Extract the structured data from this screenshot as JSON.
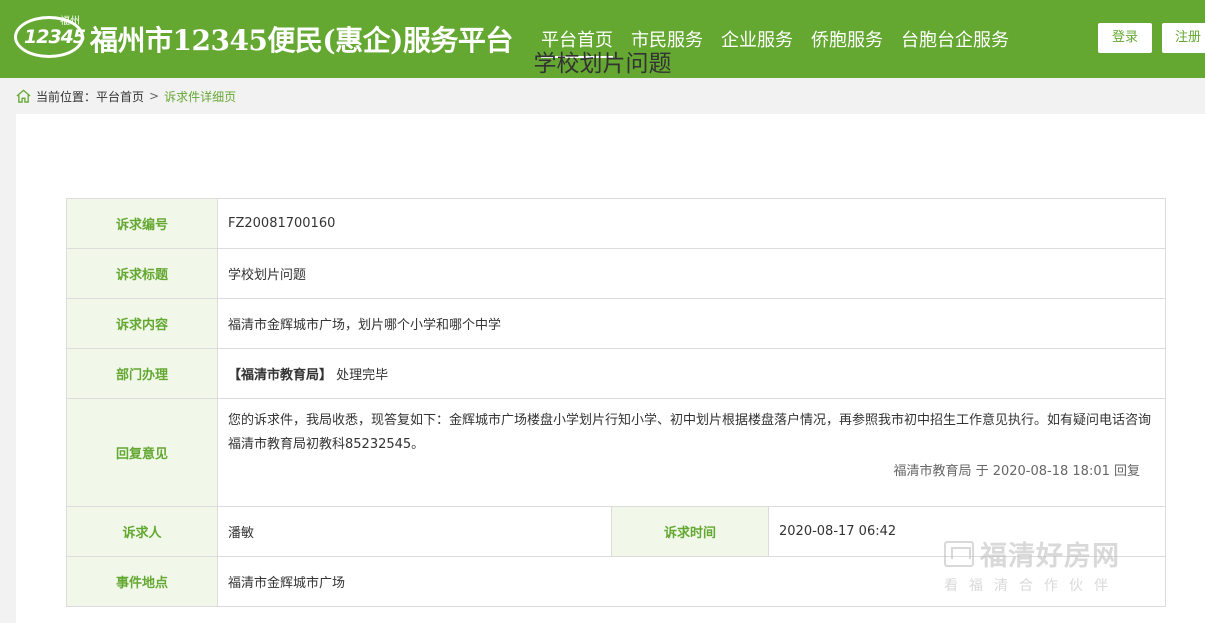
{
  "header": {
    "logo_number": "12345",
    "logo_city": "福州",
    "site_title": "福州市12345便民(惠企)服务平台",
    "nav": [
      {
        "label": "平台首页",
        "active": true
      },
      {
        "label": "市民服务",
        "active": false
      },
      {
        "label": "企业服务",
        "active": false
      },
      {
        "label": "侨胞服务",
        "active": false
      },
      {
        "label": "台胞台企服务",
        "active": false
      }
    ],
    "login_label": "登录",
    "register_label": "注册"
  },
  "breadcrumb": {
    "prefix": "当前位置：",
    "home": "平台首页",
    "separator": ">",
    "current": "诉求件详细页"
  },
  "page_title": "学校划片问题",
  "detail": {
    "case_no_label": "诉求编号",
    "case_no": "FZ20081700160",
    "subject_label": "诉求标题",
    "subject": "学校划片问题",
    "content_label": "诉求内容",
    "content": "福清市金辉城市广场，划片哪个小学和哪个中学",
    "dept_label": "部门办理",
    "dept_name": "【福清市教育局】",
    "dept_status": "处理完毕",
    "reply_label": "回复意见",
    "reply_text": "您的诉求件，我局收悉，现答复如下：金辉城市广场楼盘小学划片行知小学、初中划片根据楼盘落户情况，再参照我市初中招生工作意见执行。如有疑问电话咨询福清市教育局初教科85232545。",
    "reply_sign": "福清市教育局 于 2020-08-18 18:01 回复",
    "requester_label": "诉求人",
    "requester": "潘敏",
    "time_label": "诉求时间",
    "time": "2020-08-17 06:42",
    "location_label": "事件地点",
    "location": "福清市金辉城市广场"
  },
  "watermark": {
    "main": "福清好房网",
    "sub": "看福清合作伙伴"
  },
  "colors": {
    "brand_green": "#64a832",
    "label_bg": "#f1f8ea"
  }
}
